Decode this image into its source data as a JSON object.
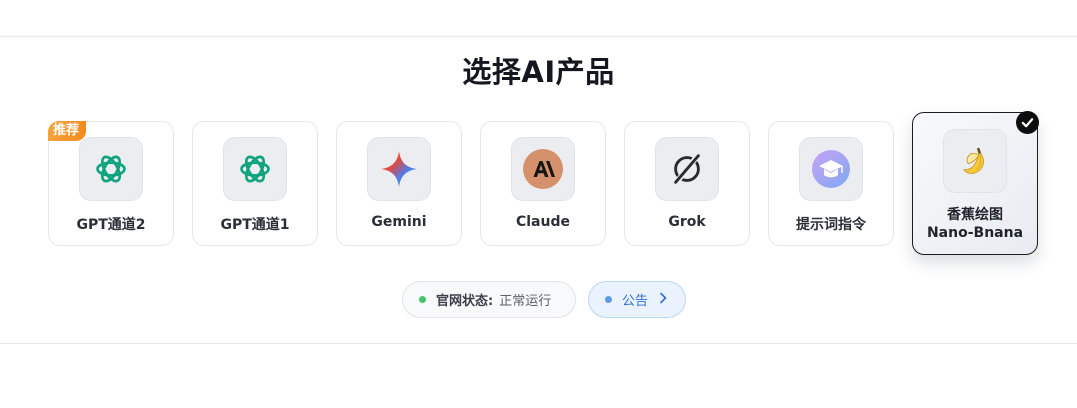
{
  "header": {
    "title": "选择AI产品"
  },
  "products": [
    {
      "label": "GPT通道2",
      "badge": "推荐",
      "icon": "openai-icon"
    },
    {
      "label": "GPT通道1",
      "icon": "openai-icon"
    },
    {
      "label": "Gemini",
      "icon": "gemini-star-icon"
    },
    {
      "label": "Claude",
      "icon": "anthropic-icon"
    },
    {
      "label": "Grok",
      "icon": "grok-icon"
    },
    {
      "label": "提示词指令",
      "icon": "graduation-cap-icon"
    },
    {
      "label_line1": "香蕉绘图",
      "label_line2": "Nano-Bnana",
      "icon": "banana-icon",
      "selected": true
    }
  ],
  "status": {
    "label": "官网状态:",
    "value": "正常运行",
    "color": "#43c46b"
  },
  "notice": {
    "label": "公告",
    "color": "#2e6fd6"
  }
}
